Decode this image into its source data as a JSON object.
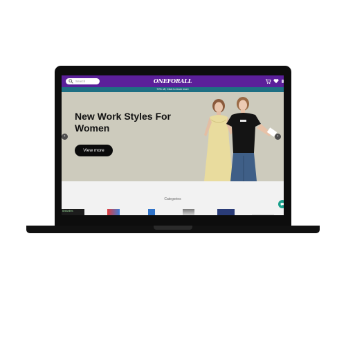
{
  "header": {
    "search_placeholder": "Search",
    "logo": "ONEFORALL",
    "icons": [
      "search-icon",
      "cart-icon",
      "heart-icon"
    ],
    "bar_color": "#5b1f9a"
  },
  "promo": {
    "text": "70% off, Click to learn more",
    "color": "#1e6f83"
  },
  "hero": {
    "title_line1": "New Work Styles For",
    "title_line2": "Women",
    "cta_label": "View more",
    "prev_icon": "chevron-left-icon",
    "next_icon": "chevron-right-icon",
    "slides_count": 4,
    "active_slide": 1
  },
  "categories": {
    "title": "Categories",
    "first_tag": "Bestsellers"
  },
  "chat": {
    "icon": "chat-icon",
    "color": "#19a08c"
  }
}
